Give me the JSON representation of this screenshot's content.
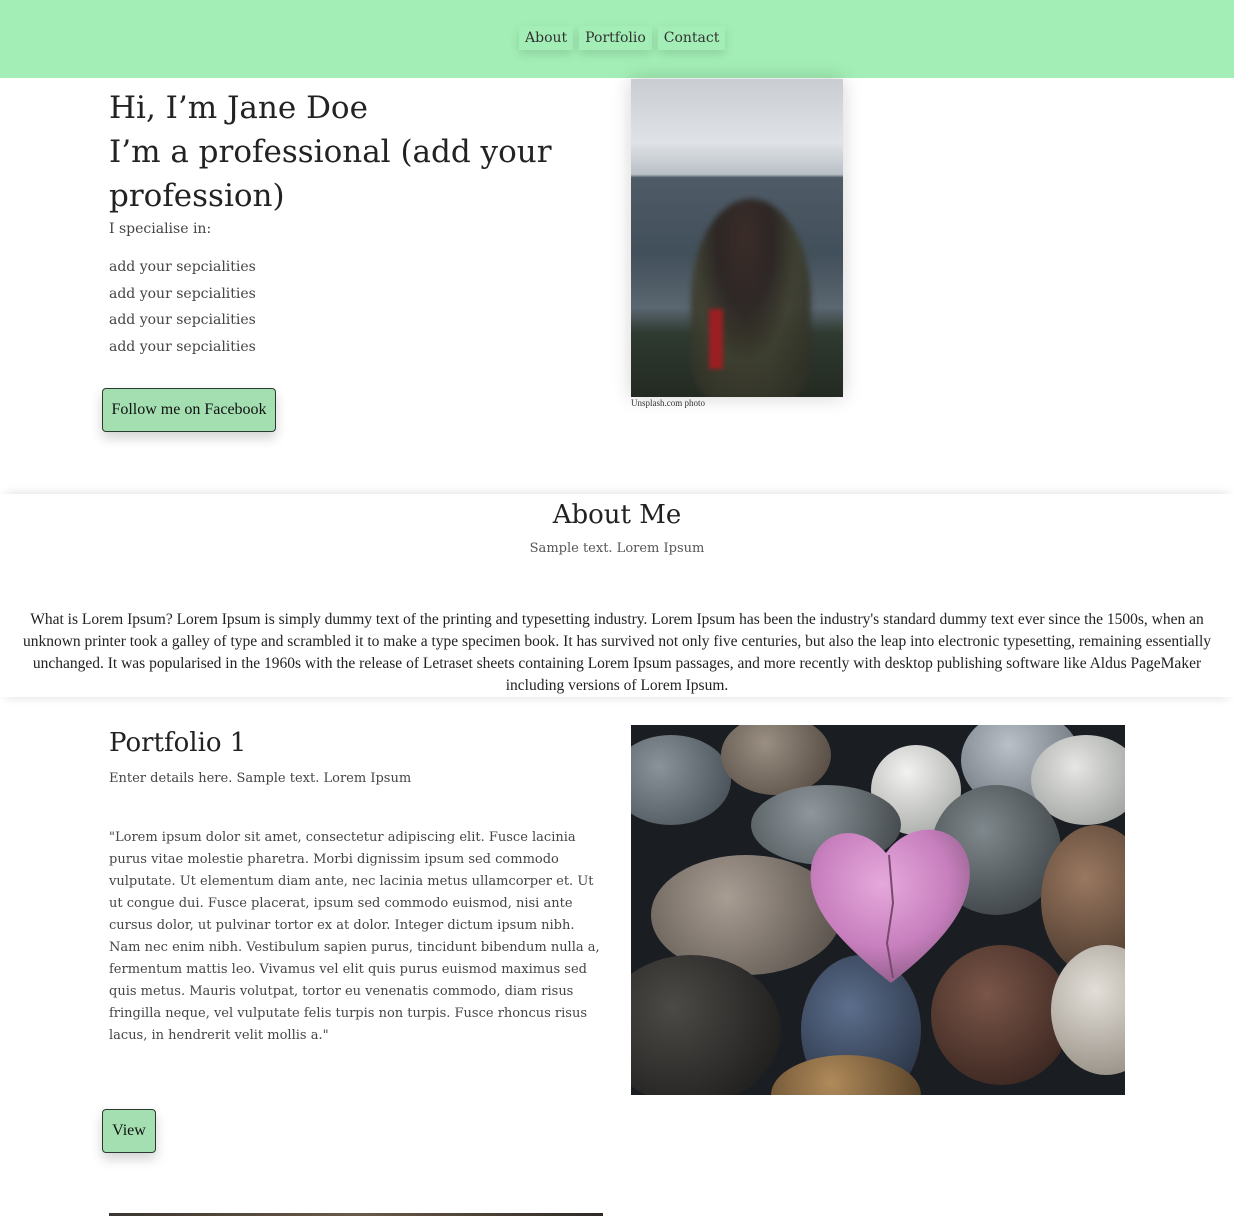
{
  "nav": {
    "items": [
      "About",
      "Portfolio",
      "Contact"
    ]
  },
  "hero": {
    "title_line1": "Hi, I’m Jane Doe",
    "title_line2": "I’m a professional (add your profession)",
    "specialise": "I specialise in:",
    "specialities": [
      "add your sepcialities",
      "add your sepcialities",
      "add your sepcialities",
      "add your sepcialities"
    ],
    "follow_button": "Follow me on Facebook",
    "photo_caption": "Unsplash.com photo"
  },
  "about": {
    "heading": "About Me",
    "subtitle": "Sample text. Lorem Ipsum",
    "body": "What is Lorem Ipsum? Lorem Ipsum is simply dummy text of the printing and typesetting industry. Lorem Ipsum has been the industry's standard dummy text ever since the 1500s, when an unknown printer took a galley of type and scrambled it to make a type specimen book. It has survived not only five centuries, but also the leap into electronic typesetting, remaining essentially unchanged. It was popularised in the 1960s with the release of Letraset sheets containing Lorem Ipsum passages, and more recently with desktop publishing software like Aldus PageMaker including versions of Lorem Ipsum."
  },
  "portfolio": {
    "title": "Portfolio 1",
    "subtitle": "Enter details here. Sample text. Lorem Ipsum",
    "quote": "\"Lorem ipsum dolor sit amet, consectetur adipiscing elit. Fusce lacinia purus vitae molestie pharetra. Morbi dignissim ipsum sed commodo vulputate. Ut elementum diam ante, nec lacinia metus ullamcorper et. Ut ut congue dui. Fusce placerat, ipsum sed commodo euismod, nisi ante cursus dolor, ut pulvinar tortor ex at dolor. Integer dictum ipsum nibh. Nam nec enim nibh. Vestibulum sapien purus, tincidunt bibendum nulla a, fermentum mattis leo. Vivamus vel elit quis purus euismod maximus sed quis metus. Mauris volutpat, tortor eu venenatis commodo, diam risus fringilla neque, vel vulputate felis turpis non turpis. Fusce rhoncus risus lacus, in hendrerit velit mollis a.\"",
    "view_button": "View"
  },
  "colors": {
    "accent": "#a3eeb6",
    "button": "#a3dfb0"
  }
}
